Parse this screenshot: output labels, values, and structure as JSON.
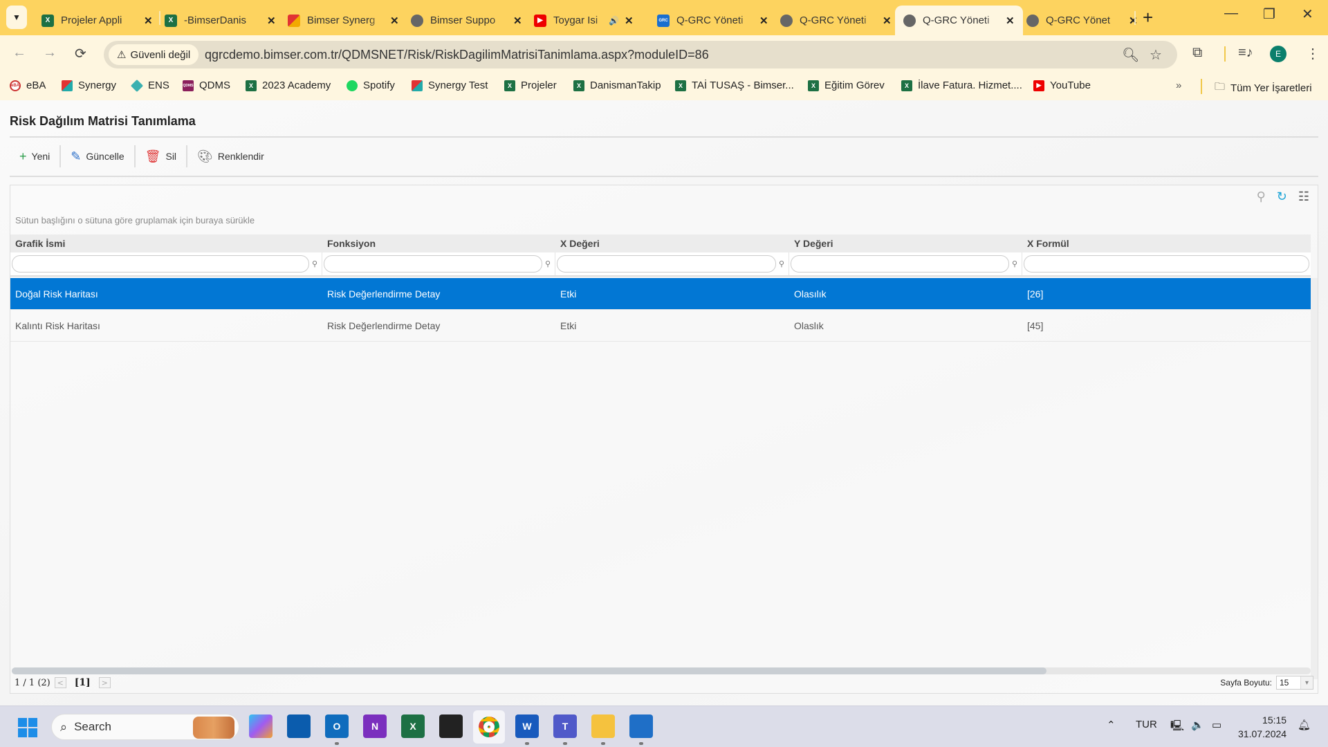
{
  "browser": {
    "tabs": [
      {
        "label": "Projeler Appli",
        "icon": "excel-icon",
        "active": false
      },
      {
        "label": "-BimserDanis",
        "icon": "excel-icon",
        "active": false
      },
      {
        "label": "Bimser Synerg",
        "icon": "synergy-icon",
        "active": false
      },
      {
        "label": "Bimser Suppo",
        "icon": "globe-icon",
        "active": false
      },
      {
        "label": "Toygar Isi",
        "icon": "youtube-icon",
        "active": false,
        "audio": true
      },
      {
        "label": "Q-GRC Yöneti",
        "icon": "qgrc-icon",
        "active": false
      },
      {
        "label": "Q-GRC Yöneti",
        "icon": "globe-icon",
        "active": false
      },
      {
        "label": "Q-GRC Yöneti",
        "icon": "globe-icon",
        "active": true
      },
      {
        "label": "Q-GRC Yönet",
        "icon": "globe-icon",
        "active": false
      }
    ],
    "security_label": "Güvenli değil",
    "url": "qgrcdemo.bimser.com.tr/QDMSNET/Risk/RiskDagilimMatrisiTanimlama.aspx?moduleID=86",
    "profile_initial": "E",
    "bookmarks": [
      {
        "label": "eBA",
        "icon": "eba-icon"
      },
      {
        "label": "Synergy",
        "icon": "synergy-icon"
      },
      {
        "label": "ENS",
        "icon": "ens-icon"
      },
      {
        "label": "QDMS",
        "icon": "qdms-icon"
      },
      {
        "label": "2023 Academy",
        "icon": "excel-icon"
      },
      {
        "label": "Spotify",
        "icon": "spotify-icon"
      },
      {
        "label": "Synergy Test",
        "icon": "synergy-icon"
      },
      {
        "label": "Projeler",
        "icon": "excel-icon"
      },
      {
        "label": "DanismanTakip",
        "icon": "excel-icon"
      },
      {
        "label": "TAİ TUSAŞ - Bimser...",
        "icon": "excel-icon"
      },
      {
        "label": "Eğitim Görev",
        "icon": "excel-icon"
      },
      {
        "label": "İlave Fatura. Hizmet....",
        "icon": "excel-icon"
      },
      {
        "label": "YouTube",
        "icon": "youtube-icon"
      }
    ],
    "more_bookmarks": "»",
    "all_bookmarks_label": "Tüm Yer İşaretleri"
  },
  "page": {
    "title": "Risk Dağılım Matrisi Tanımlama",
    "toolbar": {
      "new_label": "Yeni",
      "update_label": "Güncelle",
      "delete_label": "Sil",
      "colorize_label": "Renklendir"
    },
    "grid": {
      "group_panel_text": "Sütun başlığını o sütuna göre gruplamak için buraya sürükle",
      "columns": [
        "Grafik İsmi",
        "Fonksiyon",
        "X Değeri",
        "Y Değeri",
        "X Formül"
      ],
      "filter_values": [
        "",
        "",
        "",
        "",
        ""
      ],
      "rows": [
        {
          "cells": [
            "Doğal Risk Haritası",
            "Risk Değerlendirme Detay",
            "Etki",
            "Olasılık",
            "[26]"
          ],
          "selected": true
        },
        {
          "cells": [
            "Kalıntı Risk Haritası",
            "Risk Değerlendirme Detay",
            "Etki",
            "Olaslık",
            "[45]"
          ],
          "selected": false
        }
      ],
      "pager": {
        "summary": "1 / 1 (2)",
        "current_page": "[1]",
        "page_size_label": "Sayfa Boyutu:",
        "page_size": "15"
      }
    }
  },
  "taskbar": {
    "search_placeholder": "Search",
    "language": "TUR",
    "time": "15:15",
    "date": "31.07.2024"
  },
  "colors": {
    "accent": "#0277d4",
    "tabbar": "#fdd35f"
  }
}
